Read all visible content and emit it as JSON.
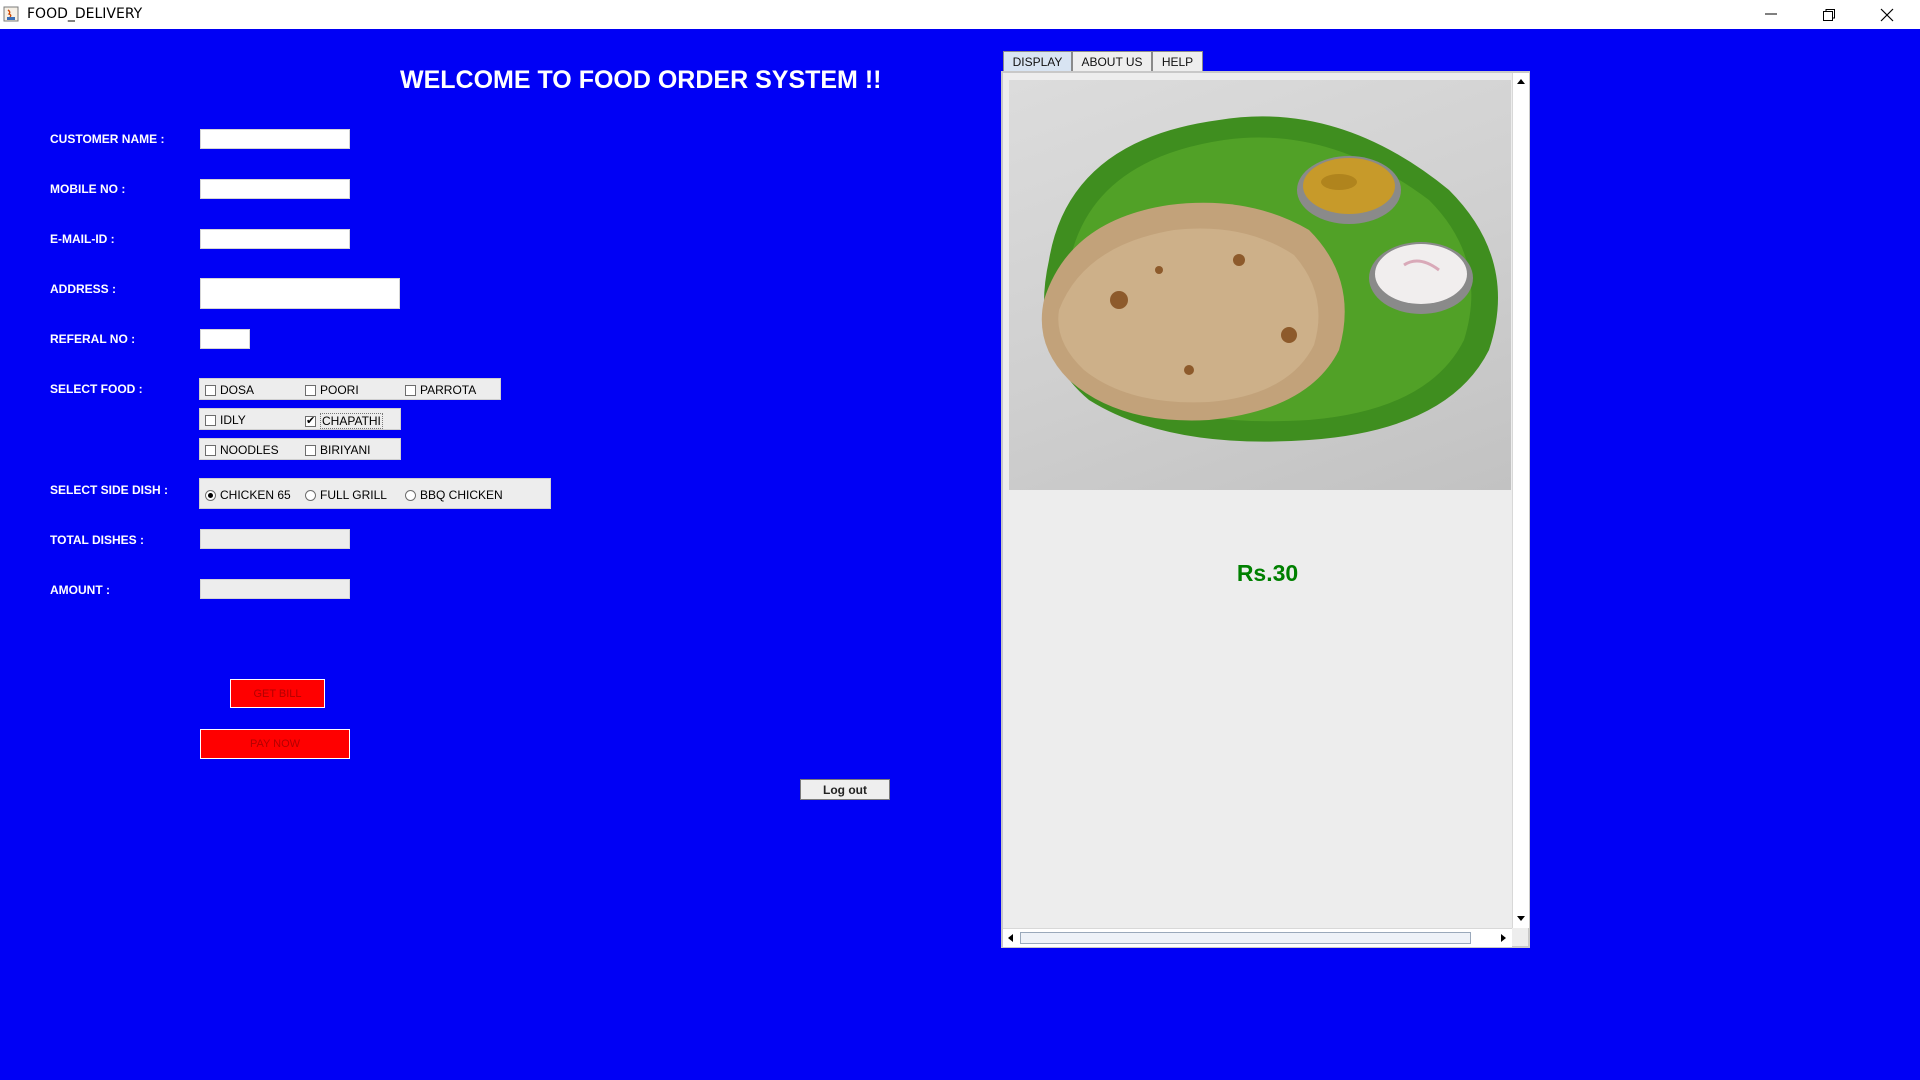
{
  "window": {
    "title": "FOOD_DELIVERY",
    "icons": [
      "java-app-icon",
      "minimize-icon",
      "restore-icon",
      "close-icon"
    ]
  },
  "form": {
    "heading": "WELCOME TO FOOD ORDER SYSTEM !!",
    "customer_name": {
      "label": "CUSTOMER NAME :",
      "value": ""
    },
    "mobile_no": {
      "label": "MOBILE NO :",
      "value": ""
    },
    "email_id": {
      "label": "E-MAIL-ID :",
      "value": ""
    },
    "address": {
      "label": "ADDRESS :",
      "value": ""
    },
    "referal_no": {
      "label": "REFERAL NO :",
      "value": ""
    },
    "select_food": {
      "label": "SELECT FOOD :",
      "options": [
        {
          "label": "DOSA",
          "checked": false
        },
        {
          "label": "POORI",
          "checked": false
        },
        {
          "label": "PARROTA",
          "checked": false
        },
        {
          "label": "IDLY",
          "checked": false
        },
        {
          "label": "CHAPATHI",
          "checked": true
        },
        {
          "label": "NOODLES",
          "checked": false
        },
        {
          "label": "BIRIYANI",
          "checked": false
        }
      ]
    },
    "select_side_dish": {
      "label": "SELECT SIDE DISH :",
      "options": [
        {
          "label": "CHICKEN 65",
          "selected": true
        },
        {
          "label": "FULL GRILL",
          "selected": false
        },
        {
          "label": "BBQ CHICKEN",
          "selected": false
        }
      ]
    },
    "total_dishes": {
      "label": "TOTAL DISHES :",
      "value": ""
    },
    "amount": {
      "label": "AMOUNT :",
      "value": ""
    },
    "get_bill_label": "GET BILL",
    "pay_now_label": "PAY NOW",
    "logout_label": "Log out"
  },
  "display_panel": {
    "tabs": [
      {
        "label": "DISPLAY",
        "active": true
      },
      {
        "label": "ABOUT US",
        "active": false
      },
      {
        "label": "HELP",
        "active": false
      }
    ],
    "image_name": "chapathi-plate-image",
    "price": "Rs.30"
  },
  "colors": {
    "background": "#0000f5",
    "button": "#ff0000",
    "price": "#008000"
  }
}
